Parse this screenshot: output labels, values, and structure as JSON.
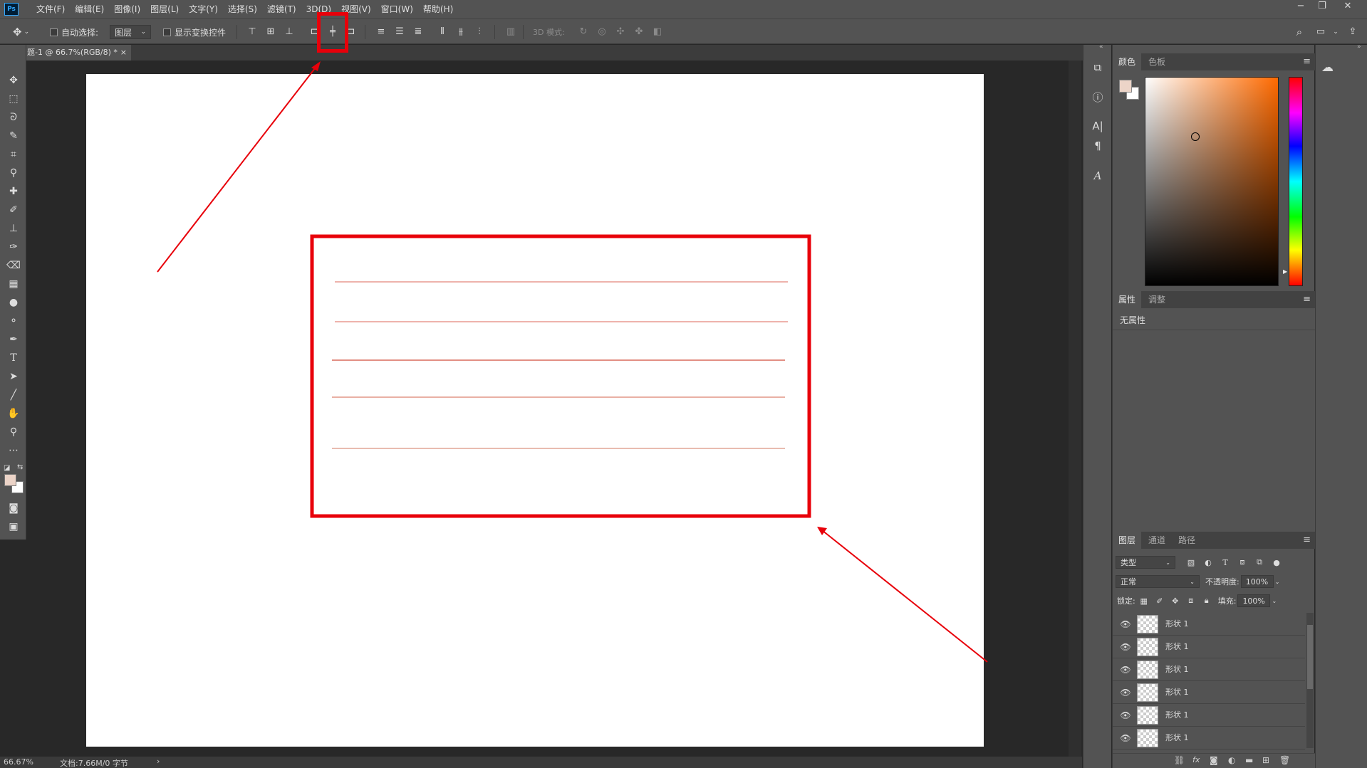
{
  "app": {
    "logo_text": "Ps"
  },
  "menu": [
    "文件(F)",
    "编辑(E)",
    "图像(I)",
    "图层(L)",
    "文字(Y)",
    "选择(S)",
    "滤镜(T)",
    "3D(D)",
    "视图(V)",
    "窗口(W)",
    "帮助(H)"
  ],
  "window_controls": {
    "minimize": "−",
    "restore": "❐",
    "close": "✕"
  },
  "options_bar": {
    "auto_select_label": "自动选择:",
    "auto_select_value": "图层",
    "show_transform_label": "显示变换控件",
    "mode_3d_label": "3D 模式:"
  },
  "document_tab": {
    "title": "题-1 @ 66.7%(RGB/8) *",
    "close": "×"
  },
  "status_bar": {
    "zoom": "66.67%",
    "doc_info": "文档:7.66M/0 字节",
    "arrow": "›"
  },
  "color_panel": {
    "tabs": [
      "颜色",
      "色板"
    ],
    "foreground": "#ecd4c8",
    "background": "#ffffff",
    "hue_color": "#ff6a00"
  },
  "properties_panel": {
    "tabs": [
      "属性",
      "调整"
    ],
    "empty_text": "无属性"
  },
  "layers_panel": {
    "tabs": [
      "图层",
      "通道",
      "路径"
    ],
    "filter_value": "类型",
    "blend_mode": "正常",
    "opacity_label": "不透明度:",
    "opacity_value": "100%",
    "lock_label": "锁定:",
    "fill_label": "填充:",
    "fill_value": "100%",
    "layers": [
      {
        "name": "形状 1"
      },
      {
        "name": "形状 1"
      },
      {
        "name": "形状 1"
      },
      {
        "name": "形状 1"
      },
      {
        "name": "形状 1"
      },
      {
        "name": "形状 1"
      }
    ]
  },
  "annotation_color": "#e8000a"
}
